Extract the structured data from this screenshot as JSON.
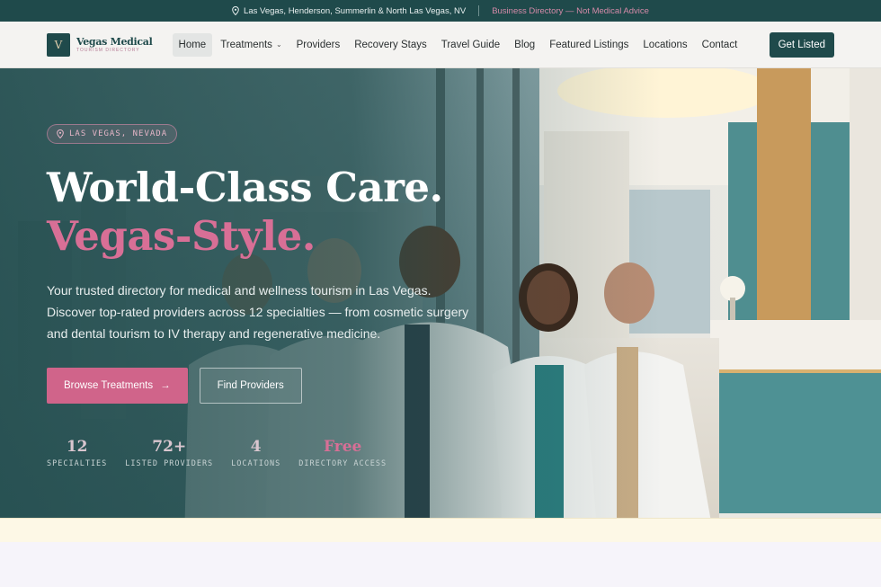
{
  "topbar": {
    "location": "Las Vegas, Henderson, Summerlin & North Las Vegas, NV",
    "note": "Business Directory — Not Medical Advice"
  },
  "nav": {
    "logo_mark": "V",
    "logo_name": "Vegas Medical",
    "logo_sub": "TOURISM DIRECTORY",
    "items": [
      {
        "label": "Home",
        "active": true
      },
      {
        "label": "Treatments",
        "dropdown": true
      },
      {
        "label": "Providers"
      },
      {
        "label": "Recovery Stays"
      },
      {
        "label": "Travel Guide"
      },
      {
        "label": "Blog"
      },
      {
        "label": "Featured Listings"
      },
      {
        "label": "Locations"
      },
      {
        "label": "Contact"
      }
    ],
    "cta": "Get Listed"
  },
  "hero": {
    "badge": "LAS VEGAS, NEVADA",
    "title_line1": "World-Class Care.",
    "title_line2": "Vegas-Style.",
    "lead": "Your trusted directory for medical and wellness tourism in Las Vegas. Discover top-rated providers across 12 specialties — from cosmetic surgery and dental tourism to IV therapy and regenerative medicine.",
    "primary_button": "Browse Treatments",
    "secondary_button": "Find Providers",
    "stats": [
      {
        "value": "12",
        "label": "SPECIALTIES"
      },
      {
        "value": "72+",
        "label": "LISTED PROVIDERS"
      },
      {
        "value": "4",
        "label": "LOCATIONS"
      },
      {
        "value": "Free",
        "label": "DIRECTORY ACCESS"
      }
    ]
  },
  "colors": {
    "brand_teal": "#1f4a4b",
    "accent_pink": "#d0648a"
  }
}
